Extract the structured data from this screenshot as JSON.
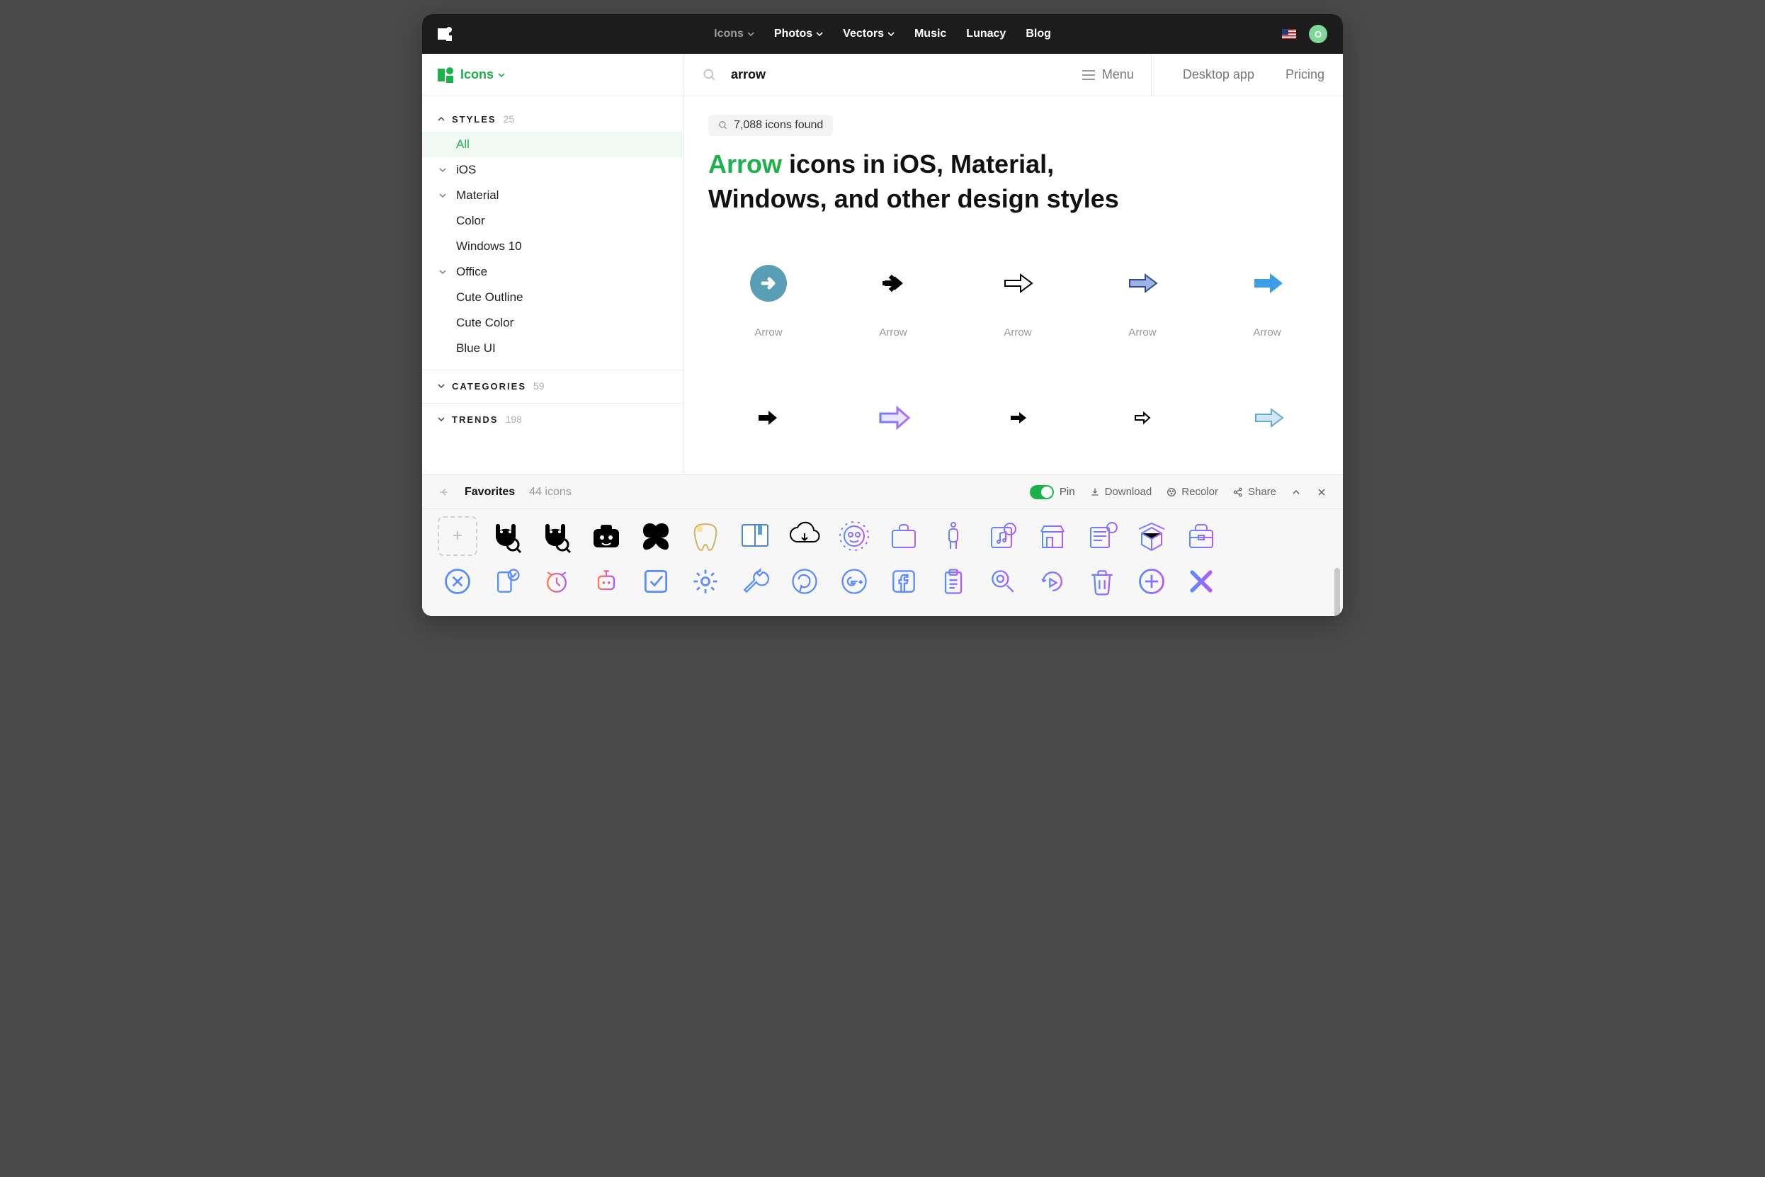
{
  "titlebar": {
    "nav": [
      "Icons",
      "Photos",
      "Vectors",
      "Music",
      "Lunacy",
      "Blog"
    ],
    "avatar_letter": "O"
  },
  "sidebar": {
    "title": "Icons",
    "sections": {
      "styles": {
        "label": "STYLES",
        "count": "25",
        "items": [
          {
            "label": "All",
            "active": true
          },
          {
            "label": "iOS",
            "expandable": true
          },
          {
            "label": "Material",
            "expandable": true
          },
          {
            "label": "Color"
          },
          {
            "label": "Windows 10"
          },
          {
            "label": "Office",
            "expandable": true
          },
          {
            "label": "Cute Outline"
          },
          {
            "label": "Cute Color"
          },
          {
            "label": "Blue UI"
          }
        ]
      },
      "categories": {
        "label": "CATEGORIES",
        "count": "59"
      },
      "trends": {
        "label": "TRENDS",
        "count": "198"
      }
    }
  },
  "topbar": {
    "search_value": "arrow",
    "menu_label": "Menu",
    "desktop_label": "Desktop app",
    "pricing_label": "Pricing"
  },
  "content": {
    "count_text": "7,088 icons found",
    "heading_accent": "Arrow",
    "heading_rest": " icons in iOS, Material, Windows, and other design styles",
    "icons_row1": [
      "Arrow",
      "Arrow",
      "Arrow",
      "Arrow",
      "Arrow"
    ]
  },
  "panel": {
    "title": "Favorites",
    "count": "44 icons",
    "pin_label": "Pin",
    "download_label": "Download",
    "recolor_label": "Recolor",
    "share_label": "Share"
  }
}
